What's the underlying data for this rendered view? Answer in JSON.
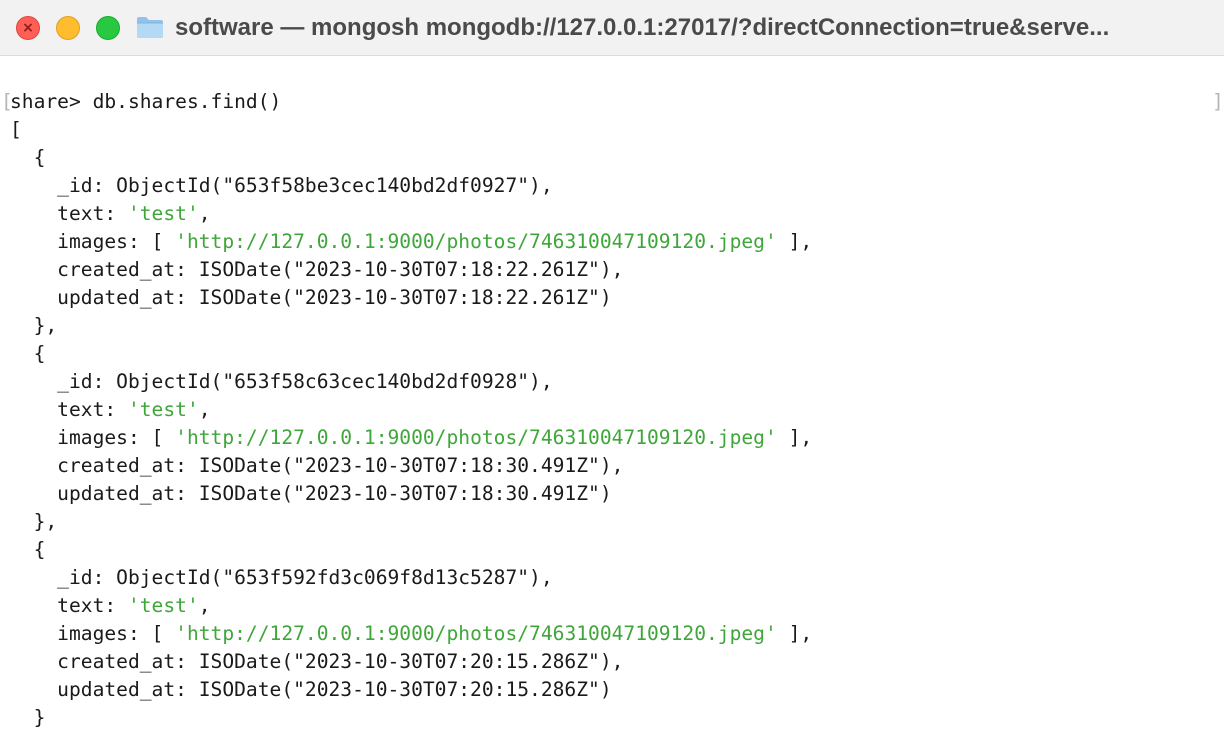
{
  "window": {
    "title": "software — mongosh mongodb://127.0.0.1:27017/?directConnection=true&serve..."
  },
  "icons": {
    "close": "close-icon",
    "minimize": "minimize-icon",
    "zoom": "zoom-icon",
    "folder": "folder-icon"
  },
  "colors": {
    "string_literal": "#3fa63a",
    "text": "#1a1a1a",
    "close": "#ff5f57",
    "minimize": "#febc2e",
    "zoom": "#28c840"
  },
  "terminal": {
    "left_mark": "[",
    "right_mark": "]",
    "prompt": "share> ",
    "command": "db.shares.find()",
    "open_array": "[",
    "documents": [
      {
        "open": "  {",
        "id_line": "    _id: ObjectId(\"653f58be3cec140bd2df0927\"),",
        "text_key": "    text: ",
        "text_value": "'test'",
        "text_end": ",",
        "images_key": "    images: [ ",
        "images_value": "'http://127.0.0.1:9000/photos/746310047109120.jpeg'",
        "images_end": " ],",
        "created_line": "    created_at: ISODate(\"2023-10-30T07:18:22.261Z\"),",
        "updated_line": "    updated_at: ISODate(\"2023-10-30T07:18:22.261Z\")",
        "close": "  },"
      },
      {
        "open": "  {",
        "id_line": "    _id: ObjectId(\"653f58c63cec140bd2df0928\"),",
        "text_key": "    text: ",
        "text_value": "'test'",
        "text_end": ",",
        "images_key": "    images: [ ",
        "images_value": "'http://127.0.0.1:9000/photos/746310047109120.jpeg'",
        "images_end": " ],",
        "created_line": "    created_at: ISODate(\"2023-10-30T07:18:30.491Z\"),",
        "updated_line": "    updated_at: ISODate(\"2023-10-30T07:18:30.491Z\")",
        "close": "  },"
      },
      {
        "open": "  {",
        "id_line": "    _id: ObjectId(\"653f592fd3c069f8d13c5287\"),",
        "text_key": "    text: ",
        "text_value": "'test'",
        "text_end": ",",
        "images_key": "    images: [ ",
        "images_value": "'http://127.0.0.1:9000/photos/746310047109120.jpeg'",
        "images_end": " ],",
        "created_line": "    created_at: ISODate(\"2023-10-30T07:20:15.286Z\"),",
        "updated_line": "    updated_at: ISODate(\"2023-10-30T07:20:15.286Z\")",
        "close": "  }"
      }
    ]
  }
}
